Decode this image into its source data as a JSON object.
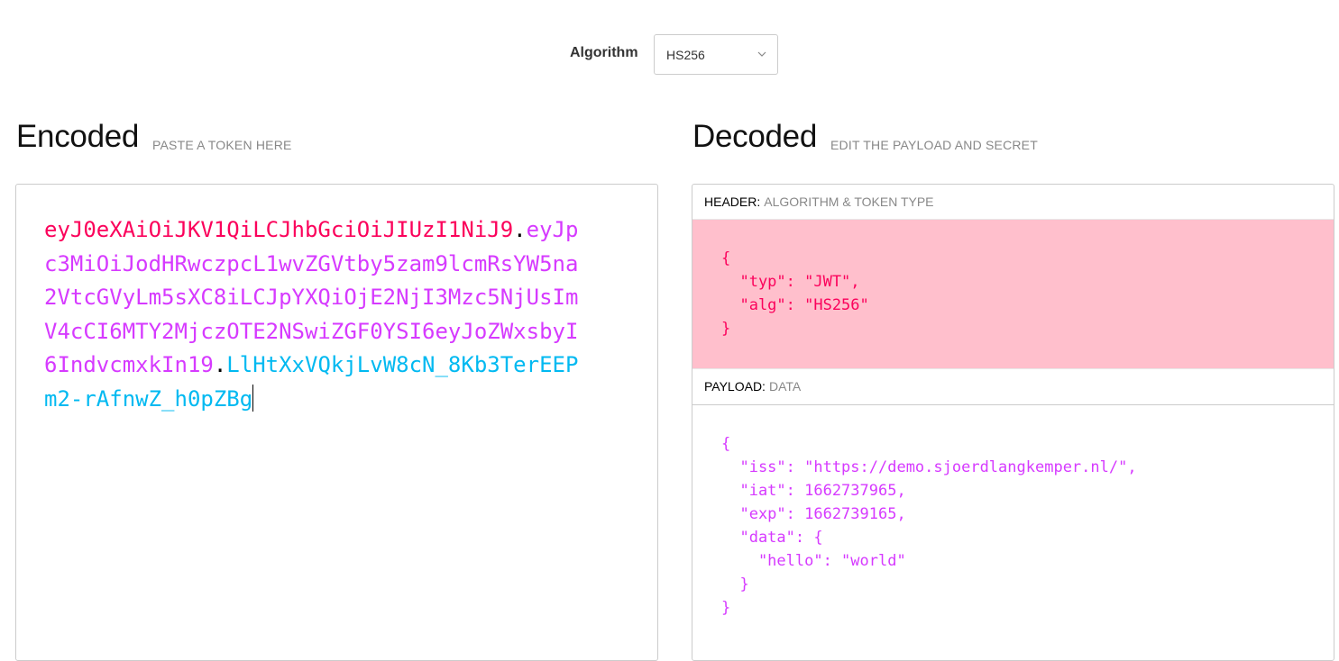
{
  "algorithm": {
    "label": "Algorithm",
    "selected": "HS256"
  },
  "encoded": {
    "title": "Encoded",
    "subtitle": "PASTE A TOKEN HERE",
    "token_header": "eyJ0eXAiOiJKV1QiLCJhbGciOiJIUzI1NiJ9",
    "token_payload": "eyJpc3MiOiJodHRwczpcL1wvZGVtby5zam9lcmRsYW5na2VtcGVyLm5sXC8iLCJpYXQiOjE2NjI3Mzc5NjUsImV4cCI6MTY2MjczOTE2NSwiZGF0YSI6eyJoZWxsbyI6IndvcmxkIn19",
    "token_signature": "LlHtXxVQkjLvW8cN_8Kb3TerEEPm2-rAfnwZ_h0pZBg",
    "dot": "."
  },
  "decoded": {
    "title": "Decoded",
    "subtitle": "EDIT THE PAYLOAD AND SECRET",
    "header_label": "HEADER:",
    "header_sublabel": "ALGORITHM & TOKEN TYPE",
    "header_json": "{\n  \"typ\": \"JWT\",\n  \"alg\": \"HS256\"\n}",
    "payload_label": "PAYLOAD:",
    "payload_sublabel": "DATA",
    "payload_json": "{\n  \"iss\": \"https://demo.sjoerdlangkemper.nl/\",\n  \"iat\": 1662737965,\n  \"exp\": 1662739165,\n  \"data\": {\n    \"hello\": \"world\"\n  }\n}"
  },
  "colors": {
    "header": "#fb015b",
    "payload": "#d63aff",
    "signature": "#00b9f1",
    "header_bg": "#ffbfcc"
  }
}
